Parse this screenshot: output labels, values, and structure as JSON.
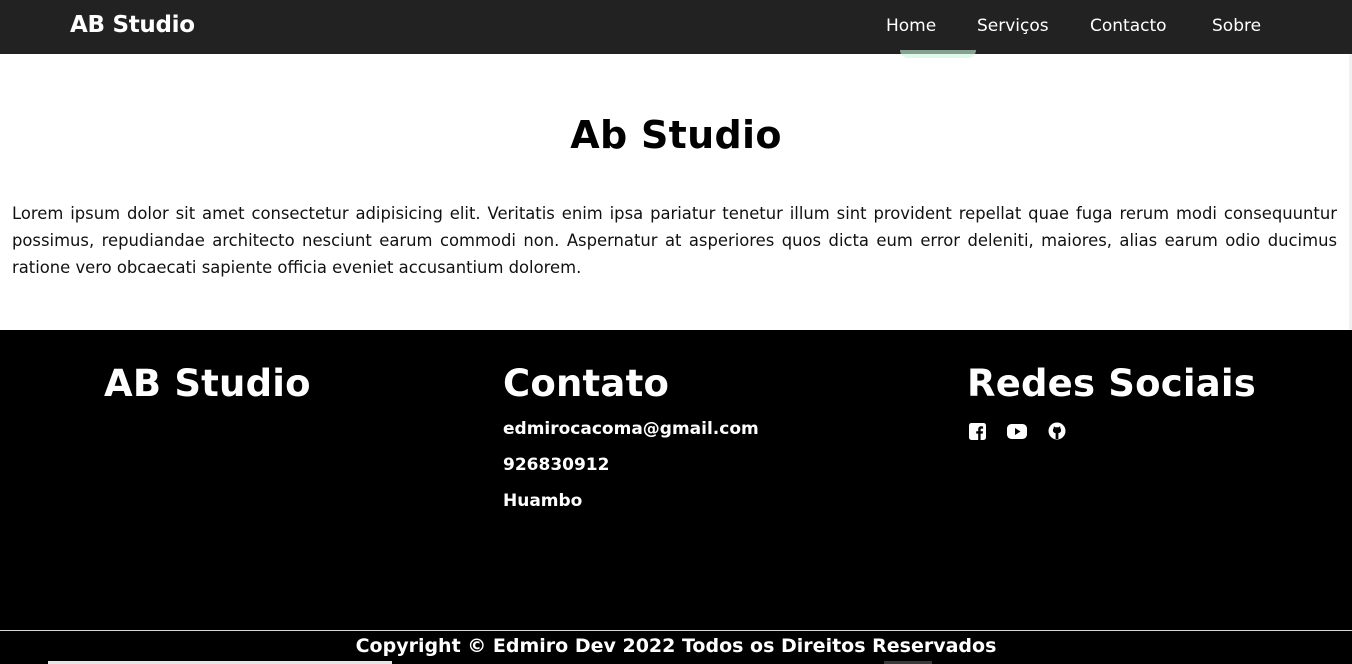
{
  "nav": {
    "brand": "AB Studio",
    "links": [
      "Home",
      "Serviços",
      "Contacto",
      "Sobre"
    ]
  },
  "main": {
    "title": "Ab Studio",
    "text": "Lorem ipsum dolor sit amet consectetur adipisicing elit. Veritatis enim ipsa pariatur tenetur illum sint provident repellat quae fuga rerum modi consequuntur possimus, repudiandae architecto nesciunt earum commodi non. Aspernatur at asperiores quos dicta eum error deleniti, maiores, alias earum odio ducimus ratione vero obcaecati sapiente officia eveniet accusantium dolorem."
  },
  "footer": {
    "brand": "AB Studio",
    "contact": {
      "heading": "Contato",
      "email": "edmirocacoma@gmail.com",
      "phone": "926830912",
      "city": "Huambo"
    },
    "social": {
      "heading": "Redes Sociais",
      "icons": [
        "facebook-icon",
        "youtube-icon",
        "github-icon"
      ]
    },
    "copyright": "Copyright © Edmiro Dev 2022 Todos os Direitos Reservados"
  },
  "colors": {
    "navbar": "#222222",
    "footer": "#000000",
    "text_light": "#ffffff",
    "text_dark": "#000000"
  }
}
